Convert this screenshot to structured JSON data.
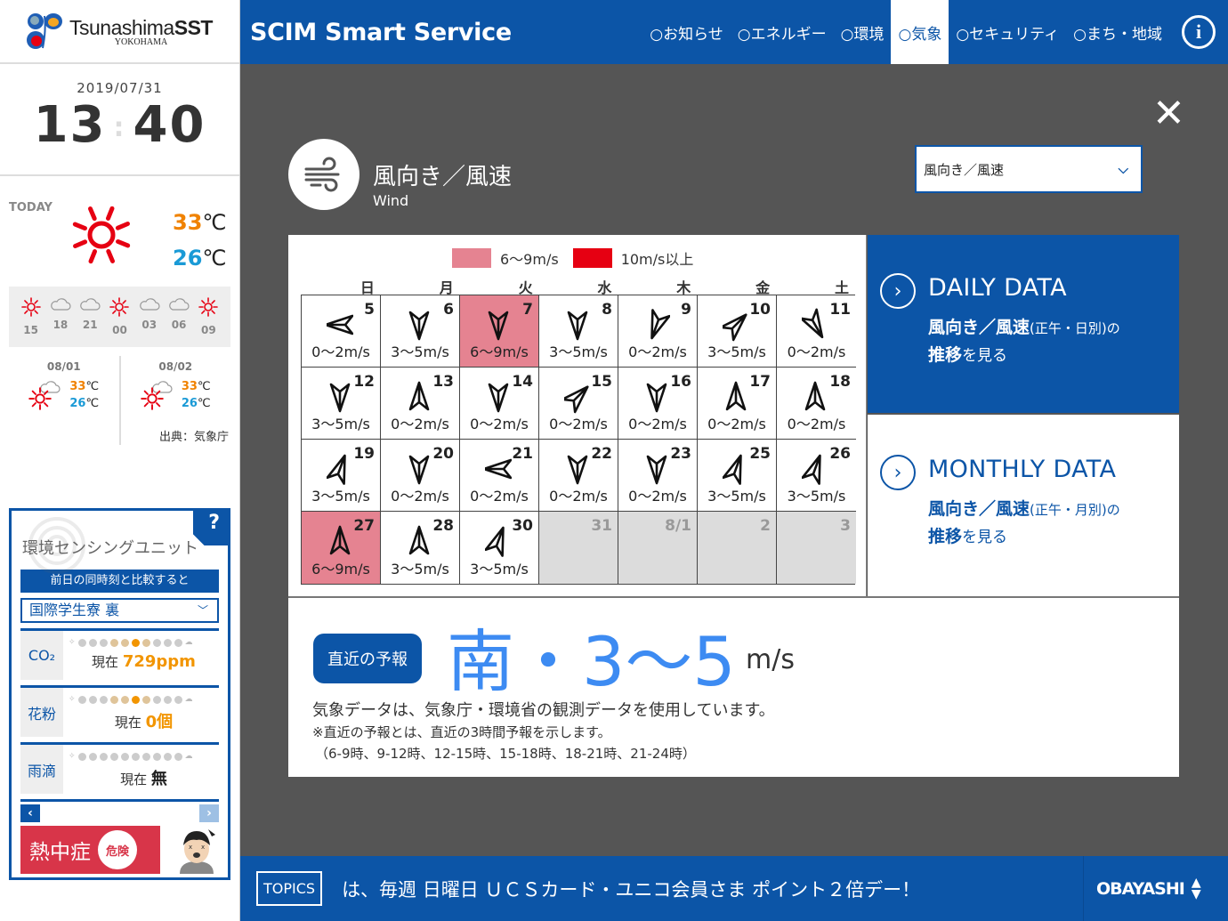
{
  "brand": {
    "name_light": "Tsunashima",
    "name_bold": "SST",
    "city": "YOKOHAMA"
  },
  "clock": {
    "date": "2019/07/31",
    "hour": "13",
    "minute": "40"
  },
  "today": {
    "label": "TODAY",
    "icon": "sun-icon",
    "high": "33",
    "low": "26",
    "unit": "℃",
    "hourly": [
      {
        "time": "15",
        "icon": "sun"
      },
      {
        "time": "18",
        "icon": "cloud"
      },
      {
        "time": "21",
        "icon": "cloud"
      },
      {
        "time": "00",
        "icon": "sun"
      },
      {
        "time": "03",
        "icon": "cloud"
      },
      {
        "time": "06",
        "icon": "cloud"
      },
      {
        "time": "09",
        "icon": "sun"
      }
    ]
  },
  "forecast_days": [
    {
      "date": "08/01",
      "icon": "sun-cloud",
      "high": "33",
      "low": "26",
      "unit": "℃"
    },
    {
      "date": "08/02",
      "icon": "sun-cloud",
      "high": "33",
      "low": "26",
      "unit": "℃"
    }
  ],
  "weather_source": "出典：気象庁",
  "sensor": {
    "title": "環境センシングユニット",
    "help": "?",
    "compare_label": "前日の同時刻と比較すると",
    "location": "国際学生寮 裏",
    "rows": [
      {
        "label": "CO₂",
        "prefix": "現在",
        "value": "729ppm",
        "level": 5,
        "levels": 10
      },
      {
        "label": "花粉",
        "prefix": "現在",
        "value": "0個",
        "level": 5,
        "levels": 10
      },
      {
        "label": "雨滴",
        "prefix": "現在",
        "value": "無",
        "level": 0,
        "levels": 10
      }
    ],
    "prev": "‹",
    "next": "›",
    "heatstroke": {
      "label": "熱中症",
      "badge": "危険"
    }
  },
  "header": {
    "app_title": "SCIM Smart Service",
    "nav": [
      {
        "label": "○お知らせ",
        "active": false
      },
      {
        "label": "○エネルギー",
        "active": false
      },
      {
        "label": "○環境",
        "active": false
      },
      {
        "label": "○気象",
        "active": true
      },
      {
        "label": "○セキュリティ",
        "active": false
      },
      {
        "label": "○まち・地域",
        "active": false
      }
    ],
    "info": "i"
  },
  "panel": {
    "close": "✕",
    "title": "風向き／風速",
    "subtitle": "Wind",
    "view_select": {
      "value": "風向き／風速",
      "chevron": "⌄"
    }
  },
  "calendar": {
    "legend": [
      {
        "label": "6〜9m/s",
        "color": "#e58391"
      },
      {
        "label": "10m/s以上",
        "color": "#e60012"
      }
    ],
    "weekdays": [
      "日",
      "月",
      "火",
      "水",
      "木",
      "金",
      "土"
    ],
    "cells": [
      {
        "day": "5",
        "dir_deg": 270,
        "speed": "0〜2m/s",
        "level": "low"
      },
      {
        "day": "6",
        "dir_deg": 180,
        "speed": "3〜5m/s",
        "level": "low"
      },
      {
        "day": "7",
        "dir_deg": 180,
        "speed": "6〜9m/s",
        "level": "mid"
      },
      {
        "day": "8",
        "dir_deg": 180,
        "speed": "3〜5m/s",
        "level": "low"
      },
      {
        "day": "9",
        "dir_deg": 200,
        "speed": "0〜2m/s",
        "level": "low"
      },
      {
        "day": "10",
        "dir_deg": 45,
        "speed": "3〜5m/s",
        "level": "low"
      },
      {
        "day": "11",
        "dir_deg": 150,
        "speed": "0〜2m/s",
        "level": "low"
      },
      {
        "day": "12",
        "dir_deg": 180,
        "speed": "3〜5m/s",
        "level": "low"
      },
      {
        "day": "13",
        "dir_deg": 0,
        "speed": "0〜2m/s",
        "level": "low"
      },
      {
        "day": "14",
        "dir_deg": 180,
        "speed": "0〜2m/s",
        "level": "low"
      },
      {
        "day": "15",
        "dir_deg": 45,
        "speed": "0〜2m/s",
        "level": "low"
      },
      {
        "day": "16",
        "dir_deg": 180,
        "speed": "0〜2m/s",
        "level": "low"
      },
      {
        "day": "17",
        "dir_deg": 0,
        "speed": "0〜2m/s",
        "level": "low"
      },
      {
        "day": "18",
        "dir_deg": 0,
        "speed": "0〜2m/s",
        "level": "low"
      },
      {
        "day": "19",
        "dir_deg": 20,
        "speed": "3〜5m/s",
        "level": "low"
      },
      {
        "day": "20",
        "dir_deg": 180,
        "speed": "0〜2m/s",
        "level": "low"
      },
      {
        "day": "21",
        "dir_deg": 270,
        "speed": "0〜2m/s",
        "level": "low"
      },
      {
        "day": "22",
        "dir_deg": 180,
        "speed": "0〜2m/s",
        "level": "low"
      },
      {
        "day": "23",
        "dir_deg": 180,
        "speed": "0〜2m/s",
        "level": "low"
      },
      {
        "day": "25",
        "dir_deg": 20,
        "speed": "3〜5m/s",
        "level": "low"
      },
      {
        "day": "26",
        "dir_deg": 20,
        "speed": "3〜5m/s",
        "level": "low"
      },
      {
        "day": "27",
        "dir_deg": 0,
        "speed": "6〜9m/s",
        "level": "mid"
      },
      {
        "day": "28",
        "dir_deg": 0,
        "speed": "3〜5m/s",
        "level": "low"
      },
      {
        "day": "30",
        "dir_deg": 20,
        "speed": "3〜5m/s",
        "level": "low"
      },
      {
        "day": "31",
        "dir_deg": null,
        "speed": "",
        "level": "none"
      },
      {
        "day": "8/1",
        "dir_deg": null,
        "speed": "",
        "level": "none"
      },
      {
        "day": "2",
        "dir_deg": null,
        "speed": "",
        "level": "none"
      },
      {
        "day": "3",
        "dir_deg": null,
        "speed": "",
        "level": "none"
      }
    ]
  },
  "links": {
    "daily": {
      "title": "DAILY DATA",
      "desc_bold1": "風向き／風速",
      "desc_small": "(正午・日別)の",
      "desc_bold2": "推移",
      "desc_tail": "を見る"
    },
    "monthly": {
      "title": "MONTHLY DATA",
      "desc_bold1": "風向き／風速",
      "desc_small": "(正午・月別)の",
      "desc_bold2": "推移",
      "desc_tail": "を見る"
    }
  },
  "forecast": {
    "badge": "直近の予報",
    "value": "南・3〜5",
    "unit": "m/s",
    "note": "気象データは、気象庁・環境省の観測データを使用しています。",
    "note2": "※直近の予報とは、直近の3時間予報を示します。",
    "note3": "（6-9時、9-12時、12-15時、15-18時、18-21時、21-24時）"
  },
  "ticker": {
    "label": "TOPICS",
    "text": "は、毎週 日曜日 ＵＣＳカード・ユニコ会員さま ポイント２倍デー！",
    "sponsor": "OBAYASHI"
  },
  "colors": {
    "brand_blue": "#0c55a7",
    "forecast_blue": "#3d8bf2",
    "hi_temp": "#f08200",
    "lo_temp": "#1a9ad6",
    "alert_red": "#d83549"
  }
}
